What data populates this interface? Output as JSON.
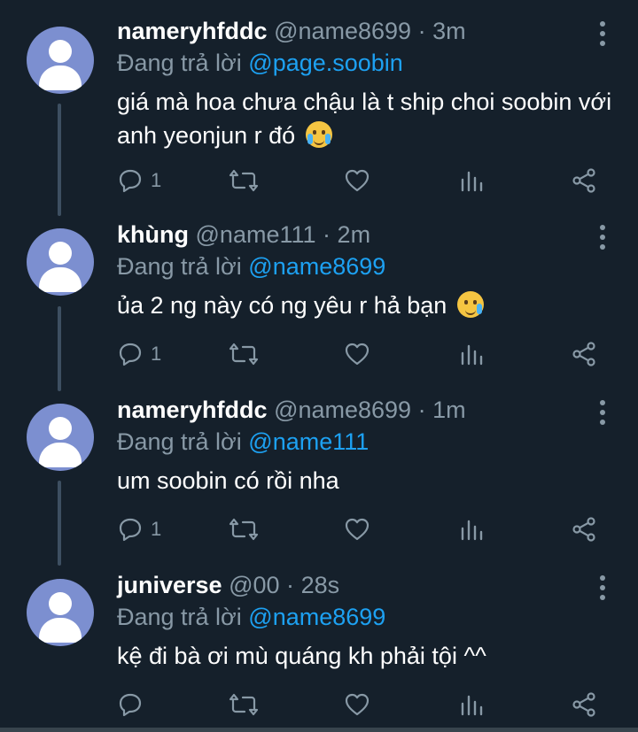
{
  "tweets": [
    {
      "name": "nameryhfddc",
      "handle": "@name8699",
      "time": "3m",
      "reply_label": "Đang trả lời",
      "reply_to": "@page.soobin",
      "text": "giá mà hoa chưa chậu là t ship choi soobin với anh yeonjun r đó",
      "emoji": "loudly-crying-face",
      "reply_count": "1"
    },
    {
      "name": "khùng",
      "handle": "@name111",
      "time": "2m",
      "reply_label": "Đang trả lời",
      "reply_to": "@name8699",
      "text": "ủa 2 ng này có ng yêu r hả bạn",
      "emoji": "smiling-face-with-tear",
      "reply_count": "1"
    },
    {
      "name": "nameryhfddc",
      "handle": "@name8699",
      "time": "1m",
      "reply_label": "Đang trả lời",
      "reply_to": "@name111",
      "text": "um soobin có rồi nha",
      "emoji": "",
      "reply_count": "1"
    },
    {
      "name": "juniverse",
      "handle": "@00",
      "time": "28s",
      "reply_label": "Đang trả lời",
      "reply_to": "@name8699",
      "text": "kệ đi bà ơi mù quáng kh phải tội ^^",
      "emoji": "",
      "reply_count": ""
    }
  ],
  "separator": "·",
  "colors": {
    "background": "#15202b",
    "text": "#ffffff",
    "muted": "#8899a6",
    "mention": "#1da1f2",
    "avatar": "#7c8fd0",
    "thread_line": "#3d4f61"
  },
  "icons": [
    "reply-icon",
    "retweet-icon",
    "like-icon",
    "analytics-icon",
    "share-icon",
    "more-icon"
  ]
}
